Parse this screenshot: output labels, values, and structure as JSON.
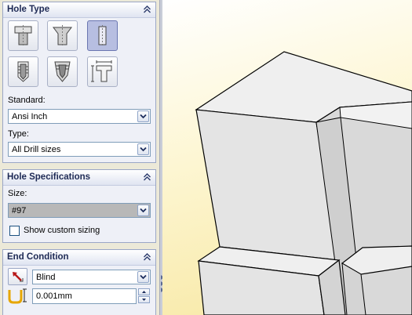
{
  "hole_type": {
    "title": "Hole Type",
    "buttons": [
      {
        "name": "counterbore-hole",
        "active": false
      },
      {
        "name": "countersink-hole",
        "active": false
      },
      {
        "name": "simple-hole",
        "active": true
      },
      {
        "name": "tapped-hole",
        "active": false
      },
      {
        "name": "pipe-tap-hole",
        "active": false
      },
      {
        "name": "legacy-hole",
        "active": false
      }
    ],
    "standard_label": "Standard:",
    "standard_value": "Ansi Inch",
    "type_label": "Type:",
    "type_value": "All Drill sizes"
  },
  "hole_specifications": {
    "title": "Hole Specifications",
    "size_label": "Size:",
    "size_value": "#97",
    "custom_sizing_label": "Show custom sizing",
    "custom_sizing_checked": false
  },
  "end_condition": {
    "title": "End Condition",
    "condition_value": "Blind",
    "depth_value": "0.001mm"
  },
  "colors": {
    "panel_bg": "#ece9d8",
    "section_border": "#9aa6c6",
    "active_button": "#b7bee1",
    "viewport_bg": "#f7e7a0"
  }
}
